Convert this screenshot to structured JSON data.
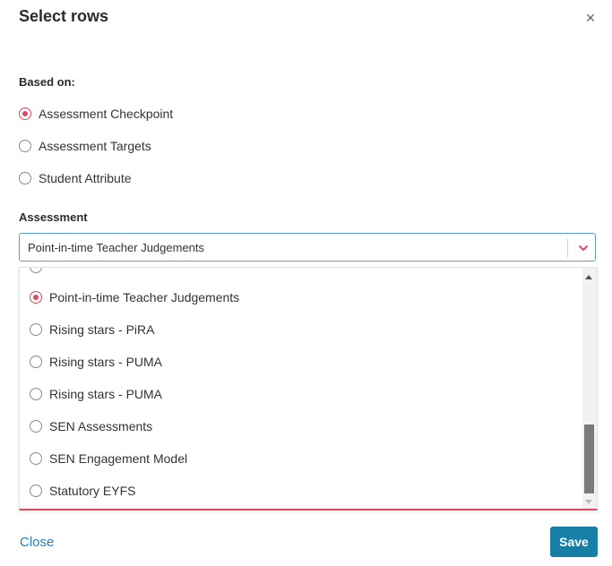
{
  "dialog": {
    "title": "Select rows",
    "close_glyph": "×"
  },
  "based_on": {
    "label": "Based on:",
    "options": [
      {
        "label": "Assessment Checkpoint",
        "checked": true
      },
      {
        "label": "Assessment Targets",
        "checked": false
      },
      {
        "label": "Student Attribute",
        "checked": false
      }
    ]
  },
  "assessment": {
    "label": "Assessment",
    "selected": "Point-in-time Teacher Judgements",
    "options": [
      {
        "label": "Point-in-time Teacher Judgements",
        "checked": true
      },
      {
        "label": "Rising stars - PiRA",
        "checked": false
      },
      {
        "label": "Rising stars - PUMA",
        "checked": false
      },
      {
        "label": "Rising stars - PUMA",
        "checked": false
      },
      {
        "label": "SEN Assessments",
        "checked": false
      },
      {
        "label": "SEN Engagement Model",
        "checked": false
      },
      {
        "label": "Statutory EYFS",
        "checked": false
      }
    ]
  },
  "footer": {
    "close_label": "Close",
    "save_label": "Save"
  },
  "colors": {
    "accent_red": "#e0485e",
    "link_blue": "#1a82c4",
    "save_teal": "#177ea6"
  },
  "icons": {
    "close": "close-icon",
    "dropdown": "chevron-down-icon"
  }
}
